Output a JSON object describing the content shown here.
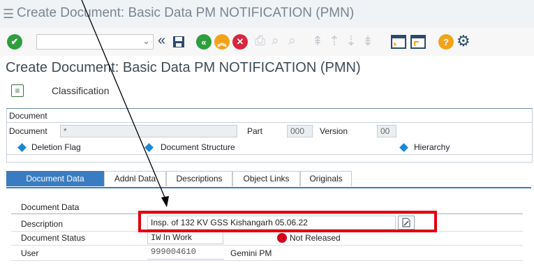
{
  "window": {
    "title": "Create Document: Basic Data PM NOTIFICATION (PMN)"
  },
  "toolbar": {
    "command_field_value": "",
    "icons": [
      "enter-check-icon",
      "command-field-dropdown-icon",
      "previous-screen-icon",
      "save-icon",
      "back-icon",
      "exit-icon",
      "cancel-icon",
      "print-icon",
      "find-icon",
      "find-next-icon",
      "first-page-icon",
      "previous-page-icon",
      "next-page-icon",
      "last-page-icon",
      "new-session-icon",
      "shortcut-icon",
      "help-icon",
      "settings-icon"
    ]
  },
  "heading": "Create Document: Basic Data PM NOTIFICATION (PMN)",
  "classification": {
    "label": "Classification"
  },
  "document_group": {
    "title": "Document",
    "document_label": "Document",
    "document_value": "*",
    "part_label": "Part",
    "part_value": "000",
    "version_label": "Version",
    "version_value": "00",
    "deletion_flag": "Deletion Flag",
    "document_structure": "Document Structure",
    "hierarchy": "Hierarchy",
    "indicator_color": "#1a87d6"
  },
  "tabs": [
    {
      "label": "Document Data",
      "active": true
    },
    {
      "label": "Addnl Data"
    },
    {
      "label": "Descriptions"
    },
    {
      "label": "Object Links"
    },
    {
      "label": "Originals"
    }
  ],
  "document_data": {
    "title": "Document Data",
    "description_label": "Description",
    "description_value": "Insp. of 132 KV GSS Kishangarh 05.06.22",
    "status_label": "Document Status",
    "status_code": "IW",
    "status_text": "In Work",
    "release_status": "Not Released",
    "release_color": "#d0021b",
    "user_label": "User",
    "user_id": "999004610",
    "user_name": "Gemini PM"
  },
  "annotation": {
    "highlight_color": "#e2000f"
  }
}
